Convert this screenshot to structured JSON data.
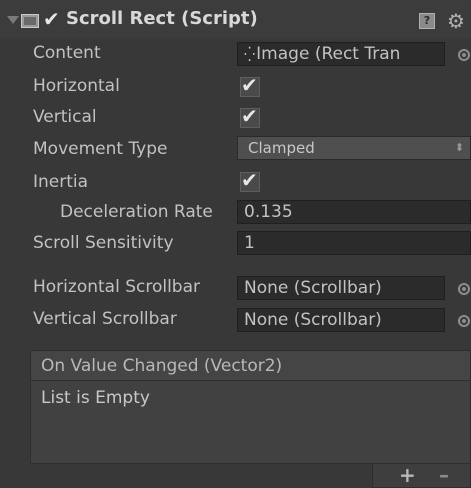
{
  "header": {
    "title": "Scroll Rect (Script)",
    "enabled": true,
    "help_glyph": "?",
    "gear_glyph": "⚙"
  },
  "properties": {
    "content": {
      "label": "Content",
      "value": "Image (Rect Tran",
      "icon": "rect-transform-icon"
    },
    "horizontal": {
      "label": "Horizontal",
      "checked": true
    },
    "vertical": {
      "label": "Vertical",
      "checked": true
    },
    "movement_type": {
      "label": "Movement Type",
      "value": "Clamped"
    },
    "inertia": {
      "label": "Inertia",
      "checked": true
    },
    "deceleration_rate": {
      "label": "Deceleration Rate",
      "value": "0.135"
    },
    "scroll_sensitivity": {
      "label": "Scroll Sensitivity",
      "value": "1"
    },
    "horizontal_scrollbar": {
      "label": "Horizontal Scrollbar",
      "value": "None (Scrollbar)"
    },
    "vertical_scrollbar": {
      "label": "Vertical Scrollbar",
      "value": "None (Scrollbar)"
    }
  },
  "event": {
    "title": "On Value Changed (Vector2)",
    "empty_text": "List is Empty",
    "add_label": "+",
    "remove_label": "–"
  },
  "check_glyph": "✔",
  "colors": {
    "background": "#383838",
    "field": "#2b2b2b",
    "text": "#c2c2c2"
  }
}
